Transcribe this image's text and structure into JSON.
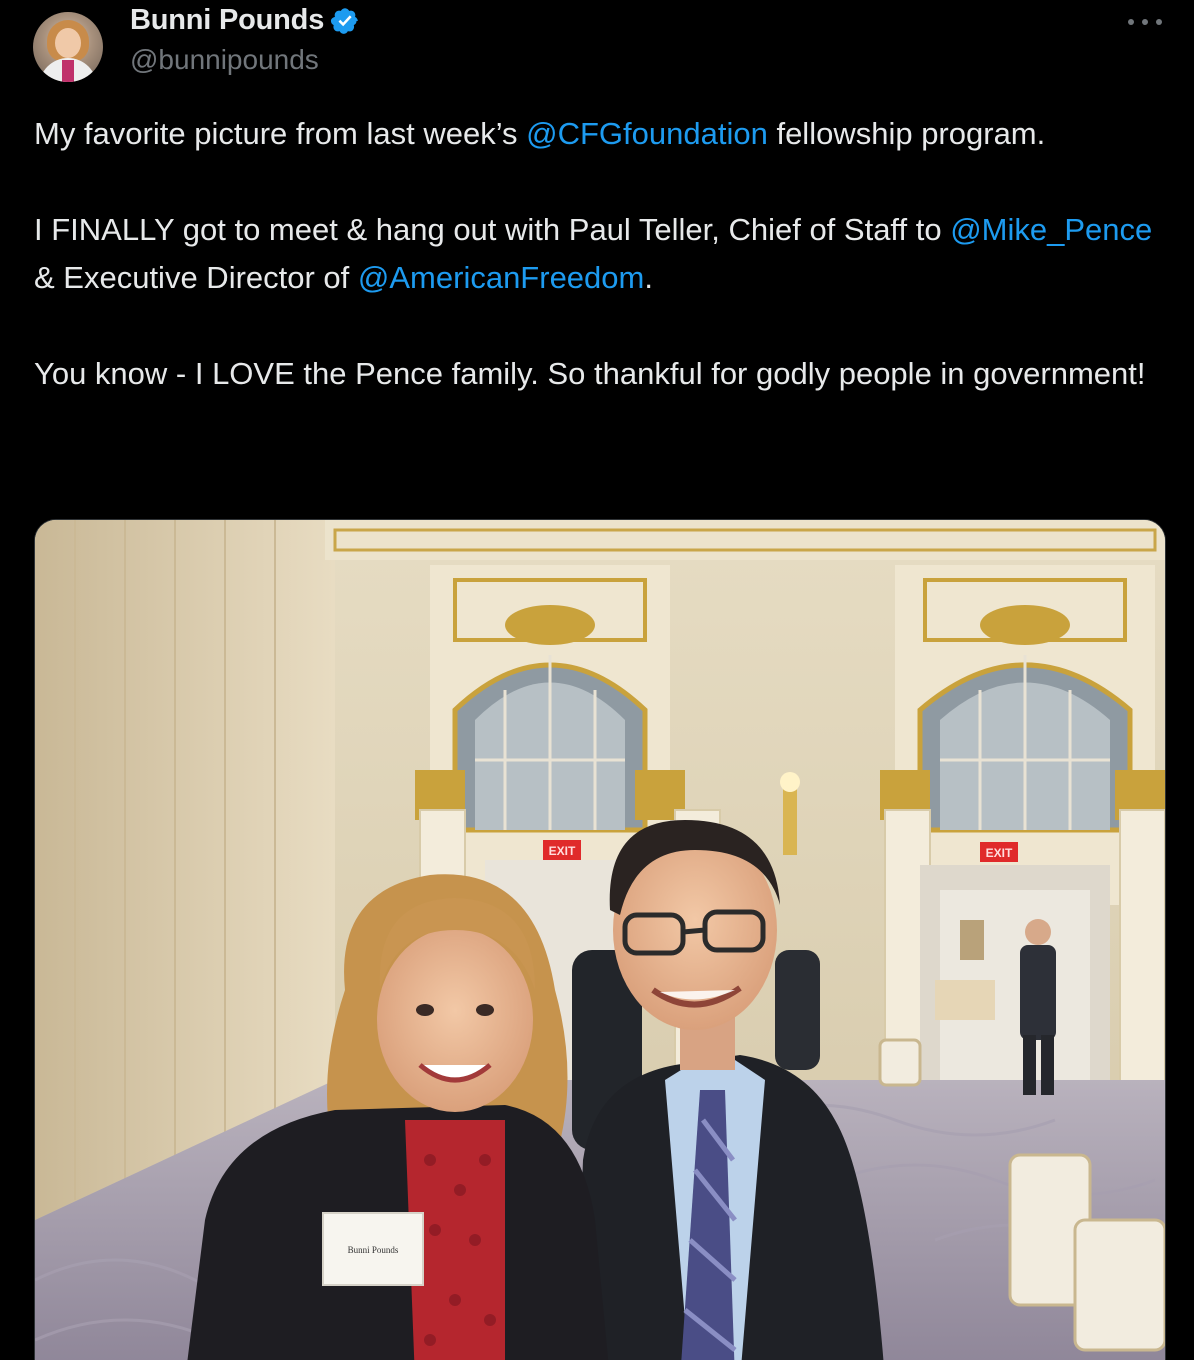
{
  "author": {
    "display_name": "Bunni Pounds",
    "handle": "@bunnipounds",
    "verified": true
  },
  "tweet": {
    "p1_a": "My favorite picture from last week’s ",
    "p1_mention": "@CFGfoundation",
    "p1_b": " fellowship program.",
    "p2_a": "I FINALLY got to meet & hang out with Paul Teller, Chief of Staff to ",
    "p2_mention1": "@Mike_Pence",
    "p2_b": " & Executive Director of ",
    "p2_mention2": "@AmericanFreedom",
    "p2_c": ".",
    "p3": "You know - I LOVE the Pence family. So thankful for godly people in government!"
  },
  "media": {
    "name_tag": "Bunni Pounds",
    "exit_sign": "EXIT"
  },
  "colors": {
    "background": "#000000",
    "text": "#e7e9ea",
    "secondary": "#71767b",
    "link": "#1d9bf0",
    "verified_badge": "#1d9bf0"
  },
  "icons": {
    "verified": "verified-badge-icon",
    "more": "more-horizontal-icon"
  }
}
